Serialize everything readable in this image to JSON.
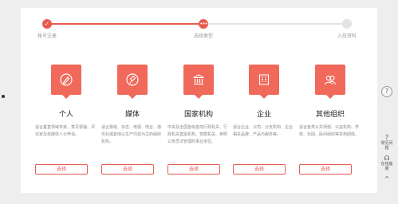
{
  "steps": [
    {
      "label": "帐号注册",
      "mark": "✓"
    },
    {
      "label": "选择类型",
      "mark": "•••"
    },
    {
      "label": "入驻资料",
      "mark": ""
    }
  ],
  "cards": [
    {
      "title": "个人",
      "icon": "pen-icon",
      "desc": "适合垂直领域专家、意见领袖、评论家及自媒体人士申请。",
      "button": "选择"
    },
    {
      "title": "媒体",
      "icon": "brush-icon",
      "desc": "适合报纸、杂志、电视、电台、通讯社或其他以生产内容为主的组织机构。",
      "button": "选择"
    },
    {
      "title": "国家机构",
      "icon": "government-building-icon",
      "desc": "中央及全国各级各地行政机关、行政机关直属机构、党群机关、参照公务员法管理的事业单位。",
      "button": "选择"
    },
    {
      "title": "企业",
      "icon": "office-building-icon",
      "desc": "适合企业、公司、分支机构、企业相关品牌、产品与服务等。",
      "button": "选择"
    },
    {
      "title": "其他组织",
      "icon": "group-icon",
      "desc": "适合各类公共场馆、公益机构、学校、社团、民间组织等机构团体。",
      "button": "选择"
    }
  ],
  "sidebar": {
    "help": "?",
    "items": [
      {
        "glyph": "?",
        "text": "常见问题"
      },
      {
        "glyph": "☊",
        "text": "在线客服"
      },
      {
        "glyph": "^",
        "text": ""
      }
    ]
  }
}
